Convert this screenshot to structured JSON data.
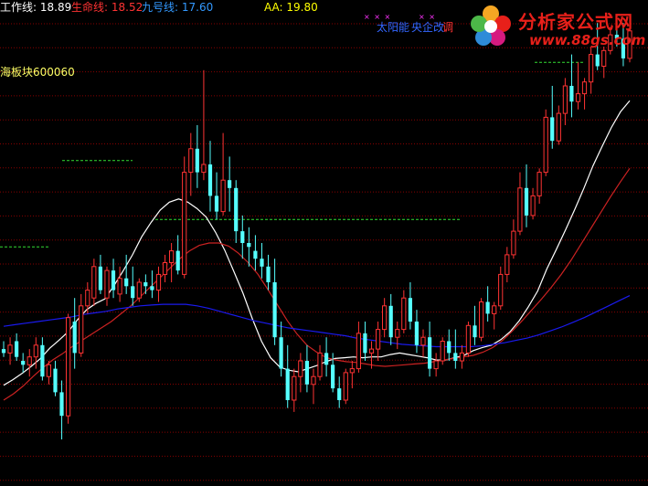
{
  "header": {
    "work_line": "工作线: 18.89",
    "life_line": "生命线: 18.52",
    "nine_line": "九号线: 17.60",
    "aa": "AA: 19.80"
  },
  "sector_label": "海板块600060",
  "concepts": [
    "太阳能",
    "央企改",
    "调"
  ],
  "logo": {
    "title": "分析家公式网",
    "url": "www.88gs.com"
  },
  "colors": {
    "background": "#000000",
    "up": "#ff3333",
    "down": "#55ffff",
    "work_line": "#ffffff",
    "life_line": "#cc2222",
    "nine_line": "#1a1aee",
    "grid": "#880000",
    "level": "#33dd33"
  },
  "chart_data": {
    "type": "candlestick",
    "ylim": [
      15.6,
      21.6
    ],
    "grid": true,
    "candles": [
      [
        17.25,
        17.35,
        17.15,
        17.2
      ],
      [
        17.2,
        17.4,
        17.05,
        17.3
      ],
      [
        17.35,
        17.45,
        17.1,
        17.15
      ],
      [
        17.1,
        17.2,
        16.95,
        17.05
      ],
      [
        17.05,
        17.25,
        16.9,
        17.15
      ],
      [
        17.15,
        17.4,
        17.0,
        17.3
      ],
      [
        17.3,
        17.4,
        16.85,
        16.9
      ],
      [
        16.9,
        17.1,
        16.8,
        17.05
      ],
      [
        17.0,
        17.1,
        16.65,
        16.7
      ],
      [
        16.7,
        16.85,
        16.1,
        16.4
      ],
      [
        16.4,
        17.7,
        16.3,
        17.65
      ],
      [
        17.6,
        17.9,
        17.0,
        17.2
      ],
      [
        17.2,
        17.95,
        17.15,
        17.8
      ],
      [
        17.8,
        18.1,
        17.7,
        18.0
      ],
      [
        17.9,
        18.4,
        17.8,
        18.3
      ],
      [
        18.3,
        18.45,
        17.95,
        18.0
      ],
      [
        17.9,
        18.3,
        17.8,
        18.25
      ],
      [
        18.25,
        18.4,
        17.9,
        18.0
      ],
      [
        17.95,
        18.3,
        17.85,
        18.15
      ],
      [
        18.15,
        18.45,
        17.95,
        18.05
      ],
      [
        18.05,
        18.3,
        17.8,
        17.9
      ],
      [
        17.9,
        18.15,
        17.85,
        18.1
      ],
      [
        18.1,
        18.2,
        17.95,
        18.05
      ],
      [
        18.05,
        18.25,
        17.9,
        18.0
      ],
      [
        18.0,
        18.3,
        17.85,
        18.2
      ],
      [
        18.2,
        18.45,
        18.1,
        18.35
      ],
      [
        18.35,
        18.6,
        18.1,
        18.5
      ],
      [
        18.5,
        18.7,
        18.2,
        18.25
      ],
      [
        18.2,
        19.7,
        18.15,
        19.5
      ],
      [
        19.5,
        20.0,
        19.2,
        19.8
      ],
      [
        19.8,
        20.1,
        19.3,
        19.5
      ],
      [
        19.5,
        20.8,
        19.4,
        19.6
      ],
      [
        19.6,
        19.9,
        19.0,
        19.2
      ],
      [
        19.2,
        19.5,
        18.9,
        19.0
      ],
      [
        19.0,
        20.0,
        18.95,
        19.4
      ],
      [
        19.4,
        19.7,
        19.0,
        19.3
      ],
      [
        19.3,
        19.4,
        18.6,
        18.75
      ],
      [
        18.75,
        18.95,
        18.4,
        18.6
      ],
      [
        18.6,
        18.8,
        18.3,
        18.55
      ],
      [
        18.5,
        18.7,
        18.25,
        18.4
      ],
      [
        18.4,
        18.6,
        18.15,
        18.3
      ],
      [
        18.3,
        18.45,
        18.0,
        18.1
      ],
      [
        18.1,
        18.4,
        17.3,
        17.4
      ],
      [
        17.4,
        17.6,
        16.9,
        17.0
      ],
      [
        17.0,
        17.3,
        16.5,
        16.6
      ],
      [
        16.6,
        17.0,
        16.45,
        16.9
      ],
      [
        16.9,
        17.2,
        16.7,
        17.1
      ],
      [
        17.1,
        17.3,
        16.7,
        16.8
      ],
      [
        16.8,
        17.0,
        16.55,
        16.9
      ],
      [
        16.9,
        17.3,
        16.85,
        17.2
      ],
      [
        17.2,
        17.4,
        16.9,
        17.05
      ],
      [
        17.05,
        17.2,
        16.7,
        16.75
      ],
      [
        16.75,
        16.9,
        16.5,
        16.6
      ],
      [
        16.6,
        17.0,
        16.55,
        16.95
      ],
      [
        16.95,
        17.1,
        16.75,
        17.0
      ],
      [
        17.0,
        17.6,
        16.95,
        17.45
      ],
      [
        17.45,
        17.6,
        17.1,
        17.2
      ],
      [
        17.2,
        17.35,
        17.0,
        17.25
      ],
      [
        17.25,
        17.6,
        17.1,
        17.5
      ],
      [
        17.5,
        17.9,
        17.4,
        17.8
      ],
      [
        17.8,
        17.95,
        17.3,
        17.4
      ],
      [
        17.4,
        17.6,
        17.25,
        17.5
      ],
      [
        17.5,
        18.0,
        17.45,
        17.9
      ],
      [
        17.9,
        18.1,
        17.5,
        17.6
      ],
      [
        17.6,
        17.75,
        17.2,
        17.3
      ],
      [
        17.3,
        17.5,
        17.15,
        17.4
      ],
      [
        17.4,
        17.6,
        16.9,
        17.0
      ],
      [
        17.0,
        17.2,
        16.9,
        17.1
      ],
      [
        17.1,
        17.4,
        17.05,
        17.35
      ],
      [
        17.35,
        17.5,
        17.1,
        17.2
      ],
      [
        17.2,
        17.5,
        17.0,
        17.1
      ],
      [
        17.1,
        17.3,
        17.0,
        17.2
      ],
      [
        17.2,
        17.6,
        17.15,
        17.55
      ],
      [
        17.55,
        17.8,
        17.3,
        17.4
      ],
      [
        17.4,
        17.9,
        17.35,
        17.85
      ],
      [
        17.85,
        18.05,
        17.6,
        17.7
      ],
      [
        17.7,
        17.85,
        17.5,
        17.8
      ],
      [
        17.8,
        18.3,
        17.75,
        18.2
      ],
      [
        18.2,
        18.55,
        18.1,
        18.45
      ],
      [
        18.45,
        18.9,
        18.4,
        18.75
      ],
      [
        18.75,
        19.5,
        18.7,
        19.3
      ],
      [
        19.3,
        19.6,
        18.8,
        18.95
      ],
      [
        18.95,
        19.3,
        18.9,
        19.2
      ],
      [
        19.2,
        19.55,
        19.1,
        19.5
      ],
      [
        19.5,
        20.3,
        19.45,
        20.2
      ],
      [
        20.2,
        20.6,
        19.8,
        19.9
      ],
      [
        19.9,
        20.35,
        19.85,
        20.25
      ],
      [
        20.25,
        20.7,
        20.1,
        20.6
      ],
      [
        20.6,
        21.0,
        20.2,
        20.4
      ],
      [
        20.4,
        20.9,
        20.3,
        20.5
      ],
      [
        20.5,
        20.7,
        20.3,
        20.65
      ],
      [
        20.65,
        21.1,
        20.5,
        21.0
      ],
      [
        21.0,
        21.4,
        20.8,
        20.85
      ],
      [
        20.85,
        21.1,
        20.7,
        21.05
      ],
      [
        21.05,
        21.35,
        21.0,
        21.25
      ],
      [
        21.25,
        21.45,
        21.1,
        21.2
      ],
      [
        21.2,
        21.4,
        20.85,
        20.95
      ],
      [
        20.95,
        21.5,
        20.9,
        21.3
      ]
    ],
    "series": [
      {
        "name": "工作线",
        "values": [
          16.79,
          16.86,
          16.94,
          17.03,
          17.13,
          17.26,
          17.36,
          17.47,
          17.62,
          17.75,
          17.83,
          17.89,
          18.06,
          18.25,
          18.45,
          18.68,
          18.86,
          19.02,
          19.12,
          19.16,
          19.12,
          19.04,
          18.93,
          18.74,
          18.51,
          18.24,
          17.96,
          17.64,
          17.35,
          17.14,
          17.02,
          16.98,
          16.96,
          17.0,
          17.04,
          17.09,
          17.13,
          17.14,
          17.15,
          17.14,
          17.15,
          17.15,
          17.18,
          17.2,
          17.18,
          17.16,
          17.14,
          17.11,
          17.11,
          17.14,
          17.17,
          17.23,
          17.27,
          17.3,
          17.37,
          17.47,
          17.61,
          17.79,
          17.99,
          18.27,
          18.51,
          18.76,
          19.02,
          19.29,
          19.58,
          19.83,
          20.07,
          20.27,
          20.41
        ]
      },
      {
        "name": "生命线",
        "values": [
          16.6,
          16.68,
          16.78,
          16.9,
          17.01,
          17.11,
          17.19,
          17.28,
          17.36,
          17.44,
          17.52,
          17.6,
          17.7,
          17.8,
          17.92,
          18.04,
          18.16,
          18.28,
          18.4,
          18.5,
          18.57,
          18.6,
          18.6,
          18.56,
          18.47,
          18.35,
          18.2,
          18.01,
          17.81,
          17.61,
          17.44,
          17.3,
          17.21,
          17.14,
          17.11,
          17.09,
          17.08,
          17.06,
          17.04,
          17.03,
          17.04,
          17.05,
          17.06,
          17.07,
          17.09,
          17.11,
          17.13,
          17.15,
          17.17,
          17.21,
          17.27,
          17.36,
          17.48,
          17.61,
          17.75,
          17.89,
          18.04,
          18.2,
          18.38,
          18.58,
          18.78,
          18.98,
          19.18,
          19.37,
          19.55
        ]
      },
      {
        "name": "九号线",
        "values": [
          17.54,
          17.56,
          17.58,
          17.6,
          17.62,
          17.64,
          17.66,
          17.69,
          17.71,
          17.73,
          17.76,
          17.78,
          17.8,
          17.81,
          17.82,
          17.82,
          17.82,
          17.8,
          17.77,
          17.73,
          17.69,
          17.65,
          17.61,
          17.58,
          17.55,
          17.52,
          17.5,
          17.48,
          17.46,
          17.44,
          17.42,
          17.39,
          17.37,
          17.35,
          17.33,
          17.31,
          17.3,
          17.29,
          17.28,
          17.28,
          17.28,
          17.28,
          17.29,
          17.31,
          17.33,
          17.36,
          17.39,
          17.43,
          17.48,
          17.53,
          17.59,
          17.65,
          17.72,
          17.79,
          17.86,
          17.93
        ]
      }
    ],
    "levels": [
      18.55,
      19.65,
      18.9,
      20.9
    ]
  }
}
